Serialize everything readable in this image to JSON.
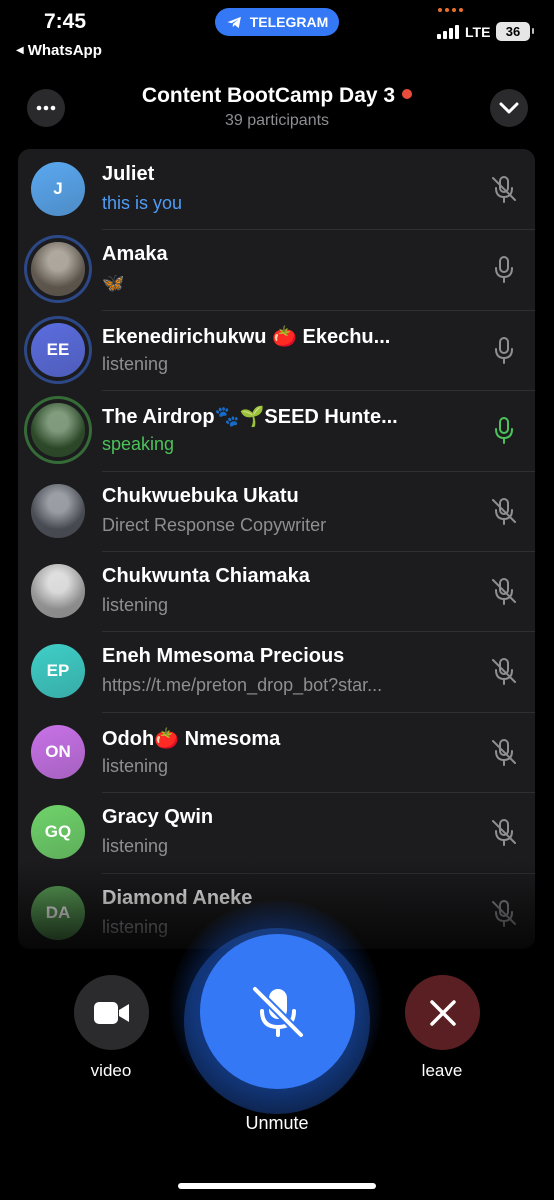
{
  "status_bar": {
    "time": "7:45",
    "back_app": "WhatsApp",
    "pill_label": "TELEGRAM",
    "network": "LTE",
    "battery": "36"
  },
  "header": {
    "title": "Content BootCamp Day 3",
    "subtitle": "39 participants"
  },
  "participants": [
    {
      "name": "Juliet",
      "status": "this is you",
      "initials": "J",
      "color": "#5aa8f0",
      "mic": "muted"
    },
    {
      "name": "Amaka",
      "status": "🦋",
      "initials": "",
      "color": "#8a7f70",
      "mic": "on"
    },
    {
      "name": "Ekenedirichukwu 🍅 Ekechu...",
      "status": "listening",
      "initials": "EE",
      "color": "#5b6de0",
      "mic": "on"
    },
    {
      "name": "The Airdrop🐾🌱SEED Hunte...",
      "status": "speaking",
      "initials": "",
      "color": "#3f6b3a",
      "mic": "speaking"
    },
    {
      "name": "Chukwuebuka Ukatu",
      "status": "Direct Response Copywriter",
      "initials": "",
      "color": "#6a6f7a",
      "mic": "muted"
    },
    {
      "name": "Chukwunta Chiamaka",
      "status": "listening",
      "initials": "",
      "color": "#d8d8d8",
      "mic": "muted"
    },
    {
      "name": "Eneh Mmesoma Precious",
      "status": "https://t.me/preton_drop_bot?star...",
      "initials": "EP",
      "color": "#3fcfc8",
      "mic": "muted"
    },
    {
      "name": "Odoh🍅 Nmesoma",
      "status": "listening",
      "initials": "ON",
      "color": "#c872e8",
      "mic": "muted"
    },
    {
      "name": "Gracy Qwin",
      "status": "listening",
      "initials": "GQ",
      "color": "#6fd36a",
      "mic": "muted"
    },
    {
      "name": "Diamond Aneke",
      "status": "listening",
      "initials": "DA",
      "color": "#5ea65a",
      "mic": "muted"
    }
  ],
  "controls": {
    "video_label": "video",
    "unmute_label": "Unmute",
    "leave_label": "leave"
  },
  "colors": {
    "accent": "#3478f6",
    "speaking": "#4cc25a",
    "you": "#4f9cf5",
    "leave": "#5a1f22"
  }
}
